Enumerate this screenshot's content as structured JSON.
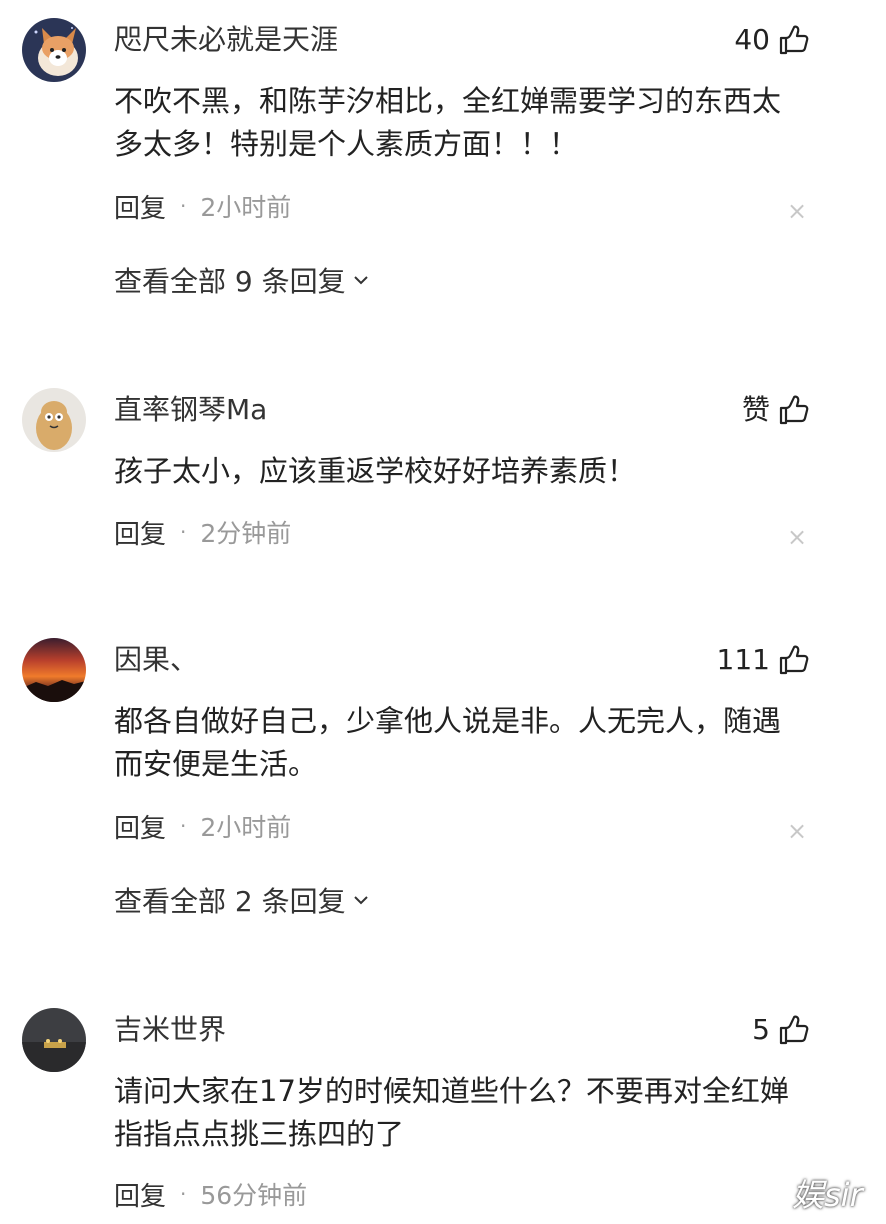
{
  "icons": {
    "like": "thumbs-up-icon",
    "close": "close-icon",
    "expand": "chevron-down-icon"
  },
  "colors": {
    "text_primary": "#222222",
    "text_secondary": "#999999",
    "close_icon": "#c8c8c8"
  },
  "comments": [
    {
      "username": "咫尺未必就是天涯",
      "likes": "40",
      "text": "不吹不黑，和陈芋汐相比，全红婵需要学习的东西太多太多！特别是个人素质方面！！！",
      "reply_label": "回复",
      "separator": "·",
      "time": "2小时前",
      "close": "×",
      "view_replies": "查看全部 9 条回复"
    },
    {
      "username": "直率钢琴Ma",
      "likes": "赞",
      "text": "孩子太小，应该重返学校好好培养素质！",
      "reply_label": "回复",
      "separator": "·",
      "time": "2分钟前",
      "close": "×"
    },
    {
      "username": "因果、",
      "likes": "111",
      "text": "都各自做好自己，少拿他人说是非。人无完人，随遇而安便是生活。",
      "reply_label": "回复",
      "separator": "·",
      "time": "2小时前",
      "close": "×",
      "view_replies": "查看全部 2 条回复"
    },
    {
      "username": "吉米世界",
      "likes": "5",
      "text": "请问大家在17岁的时候知道些什么？不要再对全红婵指指点点挑三拣四的了",
      "reply_label": "回复",
      "separator": "·",
      "time": "56分钟前"
    }
  ],
  "watermark": "娱sir"
}
